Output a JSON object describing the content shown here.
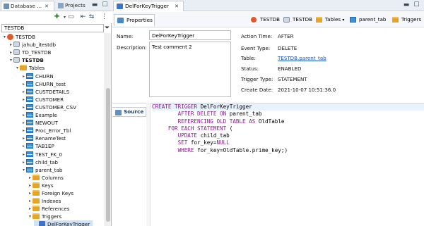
{
  "left_tabs": [
    {
      "label": "Database ...",
      "active": true
    },
    {
      "label": "Projects",
      "active": false
    }
  ],
  "filter": {
    "value": "TESTDB"
  },
  "tree": [
    {
      "label": "TESTDB",
      "depth": 0,
      "toggle": "▾",
      "icon": "connection-icon"
    },
    {
      "label": "jahub_itestdb",
      "depth": 1,
      "toggle": "▸",
      "icon": "database-icon"
    },
    {
      "label": "TD_TESTDB",
      "depth": 1,
      "toggle": "▸",
      "icon": "database-icon"
    },
    {
      "label": "TESTDB",
      "depth": 1,
      "toggle": "▾",
      "icon": "database-icon",
      "bold": true
    },
    {
      "label": "Tables",
      "depth": 2,
      "toggle": "▾",
      "icon": "folder-icon"
    },
    {
      "label": "CHURN",
      "depth": 3,
      "toggle": "▸",
      "icon": "table-icon"
    },
    {
      "label": "CHURN_test",
      "depth": 3,
      "toggle": "▸",
      "icon": "table-icon"
    },
    {
      "label": "CUSTDETAILS",
      "depth": 3,
      "toggle": "▸",
      "icon": "table-icon"
    },
    {
      "label": "CUSTOMER",
      "depth": 3,
      "toggle": "▸",
      "icon": "table-icon"
    },
    {
      "label": "CUSTOMER_CSV",
      "depth": 3,
      "toggle": "▸",
      "icon": "table-icon"
    },
    {
      "label": "Example",
      "depth": 3,
      "toggle": "▸",
      "icon": "table-icon"
    },
    {
      "label": "NEWOUT",
      "depth": 3,
      "toggle": "▸",
      "icon": "table-icon"
    },
    {
      "label": "Proc_Error_Tbl",
      "depth": 3,
      "toggle": "▸",
      "icon": "table-icon"
    },
    {
      "label": "RenameTest",
      "depth": 3,
      "toggle": "▸",
      "icon": "table-icon"
    },
    {
      "label": "TAB1EP",
      "depth": 3,
      "toggle": "▸",
      "icon": "table-icon"
    },
    {
      "label": "TEST_FK_0",
      "depth": 3,
      "toggle": "▸",
      "icon": "table-icon"
    },
    {
      "label": "child_tab",
      "depth": 3,
      "toggle": "▸",
      "icon": "table-icon"
    },
    {
      "label": "parent_tab",
      "depth": 3,
      "toggle": "▾",
      "icon": "table-icon"
    },
    {
      "label": "Columns",
      "depth": 4,
      "toggle": "▸",
      "icon": "folder-icon"
    },
    {
      "label": "Keys",
      "depth": 4,
      "toggle": "▸",
      "icon": "folder-icon"
    },
    {
      "label": "Foreign Keys",
      "depth": 4,
      "toggle": "▸",
      "icon": "folder-icon"
    },
    {
      "label": "Indexes",
      "depth": 4,
      "toggle": "▸",
      "icon": "folder-icon"
    },
    {
      "label": "References",
      "depth": 4,
      "toggle": "▸",
      "icon": "folder-icon"
    },
    {
      "label": "Triggers",
      "depth": 4,
      "toggle": "▾",
      "icon": "folder-icon"
    },
    {
      "label": "DelForKeyTrigger",
      "depth": 5,
      "toggle": "",
      "icon": "trigger-icon",
      "selected": true
    }
  ],
  "editor_tab": {
    "label": "DelForKeyTrigger"
  },
  "properties_tab": {
    "label": "Properties"
  },
  "breadcrumbs": [
    "TESTDB",
    "TESTDB",
    "Tables",
    "parent_tab",
    "Triggers"
  ],
  "props": {
    "name_label": "Name:",
    "name_value": "DelForKeyTrigger",
    "desc_label": "Description:",
    "desc_value": "Test comment 2",
    "action_time_label": "Action Time:",
    "action_time_value": "AFTER",
    "event_type_label": "Event Type:",
    "event_type_value": "DELETE",
    "table_label": "Table:",
    "table_value": "TESTDB.parent_tab",
    "status_label": "Status:",
    "status_value": "ENABLED",
    "trigger_type_label": "Trigger Type:",
    "trigger_type_value": "STATEMENT",
    "create_date_label": "Create Date:",
    "create_date_value": "2021-10-07 10:51:36.0"
  },
  "source_tab": {
    "label": "Source"
  },
  "code_lines": [
    "CREATE TRIGGER DelForKeyTrigger",
    "        AFTER DELETE ON parent_tab",
    "        REFERENCING OLD TABLE AS OldTable",
    "     FOR EACH STATEMENT (",
    "        UPDATE child_tab",
    "        SET for_key=NULL",
    "        WHERE for_key=OldTable.prime_key;)"
  ]
}
